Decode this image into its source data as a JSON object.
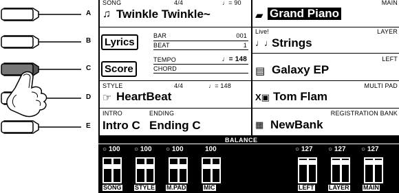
{
  "side_buttons": [
    {
      "letter": "A"
    },
    {
      "letter": "B"
    },
    {
      "letter": "C"
    },
    {
      "letter": "D"
    },
    {
      "letter": "E"
    }
  ],
  "song": {
    "label": "SONG",
    "time_sig": "4/4",
    "tempo": "♩= 90",
    "name": "Twinkle Twinkle~"
  },
  "lyrics_button": "Lyrics",
  "score_button": "Score",
  "info": {
    "bar_label": "BAR",
    "bar_value": "001",
    "beat_label": "BEAT",
    "beat_value": "1",
    "tempo_label": "TEMPO",
    "tempo_value": "♩= 148",
    "chord_label": "CHORD"
  },
  "style": {
    "label": "STYLE",
    "time_sig": "4/4",
    "tempo": "♩= 148",
    "name": "HeartBeat"
  },
  "intro": {
    "intro_label": "INTRO",
    "ending_label": "ENDING",
    "intro_value": "Intro C",
    "ending_value": "Ending C"
  },
  "voices": {
    "main_label": "MAIN",
    "main_name": "Grand Piano",
    "live_label": "Live!",
    "layer_label": "LAYER",
    "layer_name": "Strings",
    "left_label": "LEFT",
    "left_name": "Galaxy EP",
    "multipad_label": "MULTI PAD",
    "multipad_name": "Tom Flam",
    "regbank_label": "REGISTRATION BANK",
    "regbank_name": "NewBank"
  },
  "balance": {
    "title": "BALANCE",
    "channels": [
      {
        "label": "SONG",
        "value": "100",
        "circle": true
      },
      {
        "label": "STYLE",
        "value": "100",
        "circle": true
      },
      {
        "label": "M.PAD",
        "value": "100",
        "circle": true
      },
      {
        "label": "MIC",
        "value": "100",
        "circle": false
      },
      {
        "label": "LEFT",
        "value": "127",
        "circle": true
      },
      {
        "label": "LAYER",
        "value": "127",
        "circle": true
      },
      {
        "label": "MAIN",
        "value": "127",
        "circle": true
      }
    ]
  }
}
